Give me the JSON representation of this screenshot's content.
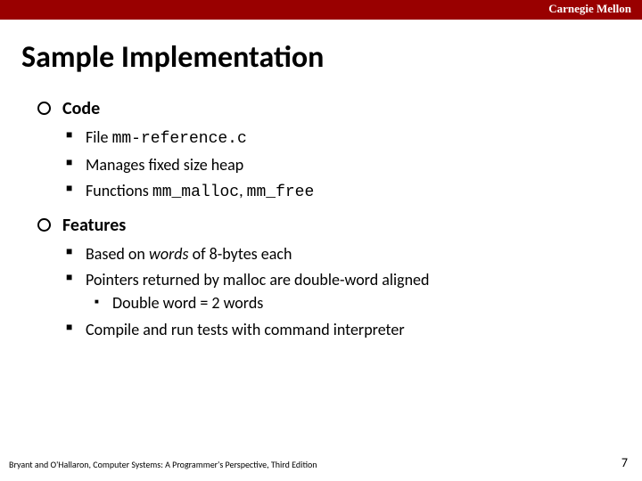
{
  "brand": "Carnegie Mellon",
  "title": "Sample Implementation",
  "sections": [
    {
      "heading": "Code",
      "items": [
        {
          "prefix": "File ",
          "code": "mm-reference.c",
          "suffix": ""
        },
        {
          "text": "Manages fixed size heap"
        },
        {
          "prefix": "Functions ",
          "code": "mm_malloc",
          "mid": ", ",
          "code2": "mm_free"
        }
      ]
    },
    {
      "heading": "Features",
      "items": [
        {
          "prefix": "Based on ",
          "ital": "words",
          "suffix": " of 8-bytes each"
        },
        {
          "text": "Pointers returned by malloc are double-word aligned",
          "sub": [
            {
              "text": "Double word = 2 words"
            }
          ]
        },
        {
          "text": "Compile and run tests with command interpreter"
        }
      ]
    }
  ],
  "footer_left": "Bryant and O'Hallaron, Computer Systems: A Programmer's Perspective, Third Edition",
  "page_number": "7"
}
